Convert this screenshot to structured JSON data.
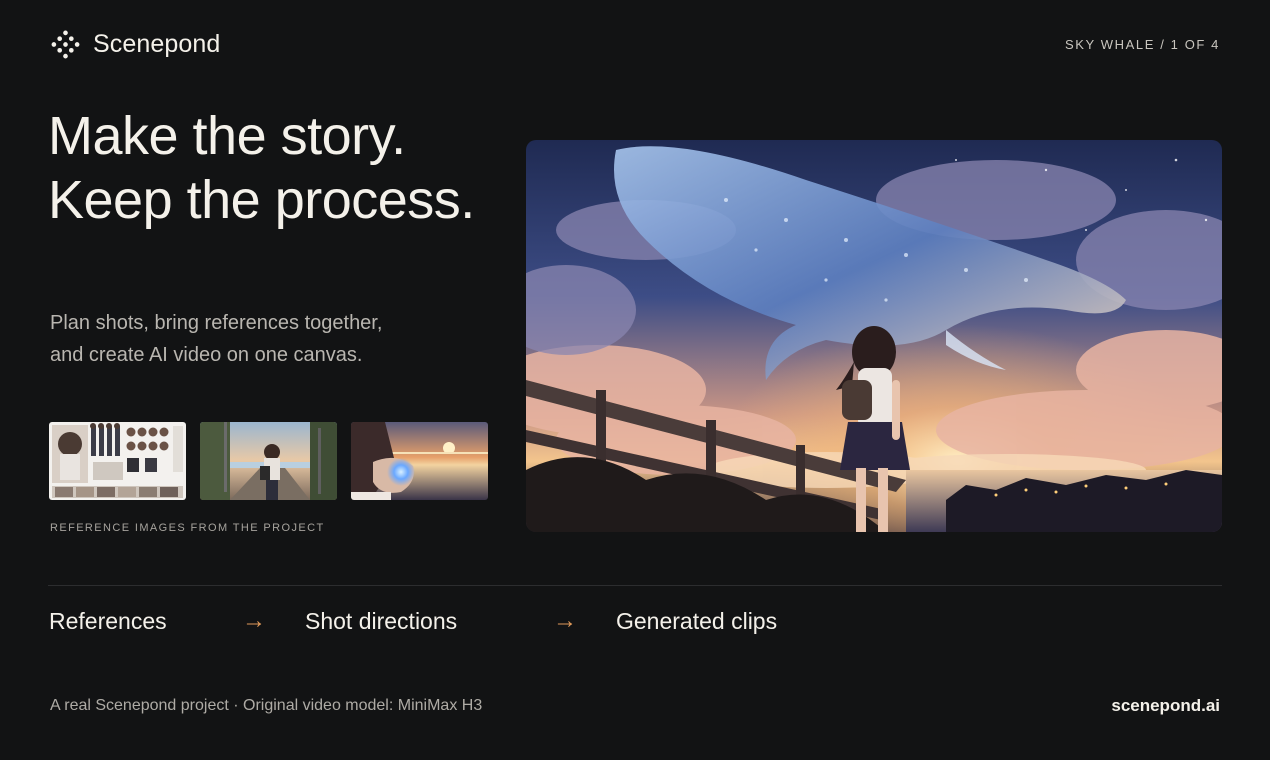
{
  "header": {
    "brand_name": "Scenepond",
    "logo_icon": "dot-grid-logo-icon",
    "counter": "SKY WHALE / 1 OF 4"
  },
  "hero_text": {
    "headline_line1": "Make the story.",
    "headline_line2": "Keep the process.",
    "subtitle_line1": "Plan shots, bring references together,",
    "subtitle_line2": "and create AI video on one canvas."
  },
  "references": {
    "caption": "REFERENCE IMAGES FROM THE PROJECT",
    "items": [
      {
        "name": "character-sheet"
      },
      {
        "name": "street-scene"
      },
      {
        "name": "sunset-hands"
      }
    ]
  },
  "flow": {
    "steps": [
      "References",
      "Shot directions",
      "Generated clips"
    ],
    "arrow": "→",
    "arrow_color": "#e09a5a"
  },
  "footer": {
    "note": "A real Scenepond project · Original video model: MiniMax H3",
    "link": "scenepond.ai"
  },
  "colors": {
    "background": "#121314",
    "text": "#f2efe8",
    "muted": "#b9b6b0",
    "accent": "#e09a5a"
  }
}
